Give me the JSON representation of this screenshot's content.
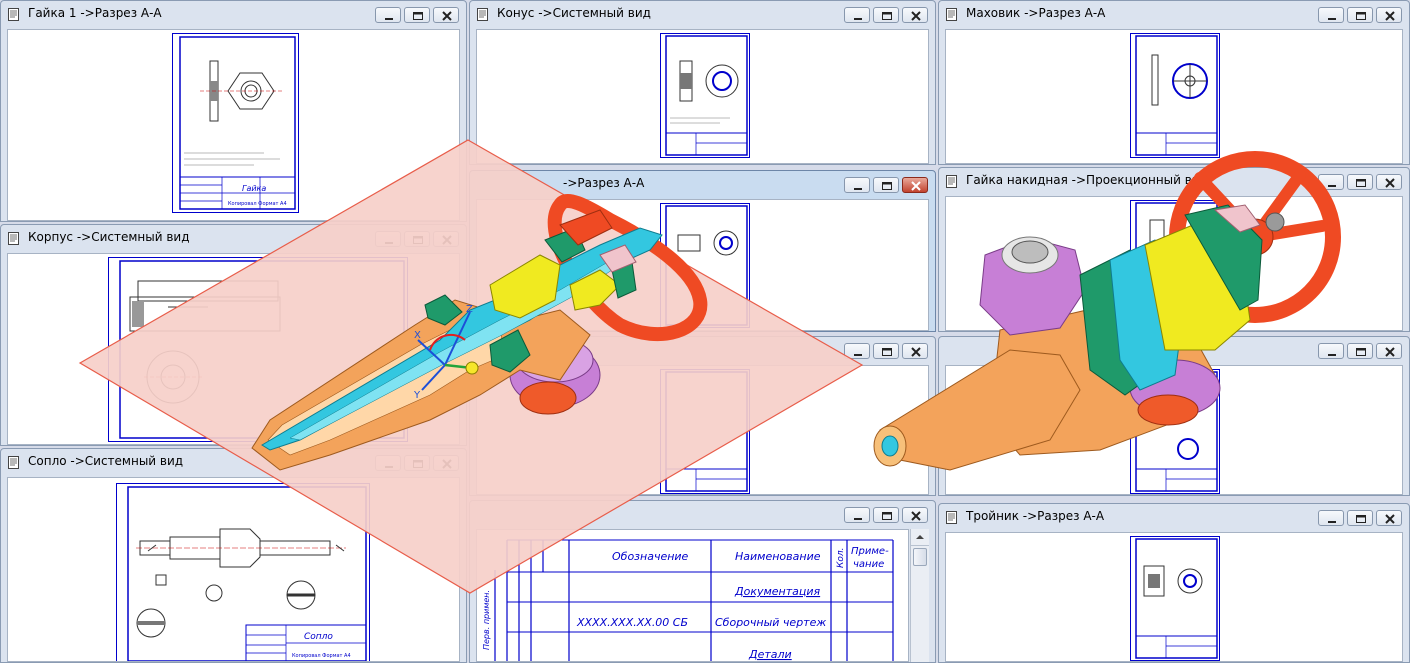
{
  "windows": [
    {
      "id": "gaika1",
      "title": "Гайка 1 ->Разрез А-А"
    },
    {
      "id": "konus",
      "title": "Конус ->Системный вид"
    },
    {
      "id": "mahovik",
      "title": "Маховик ->Разрез А-А"
    },
    {
      "id": "korpus",
      "title": "Корпус ->Системный вид"
    },
    {
      "id": "active",
      "title": "->Разрез А-А"
    },
    {
      "id": "nakidnaya",
      "title": "Гайка накидная ->Проекционный вид"
    },
    {
      "id": "soplo",
      "title": "Сопло ->Системный вид"
    },
    {
      "id": "spec",
      "title": ""
    },
    {
      "id": "hidden1",
      "title": ""
    },
    {
      "id": "hidden2",
      "title": ""
    },
    {
      "id": "troinik",
      "title": "Тройник ->Разрез А-А"
    }
  ],
  "spec_table": {
    "col_oboznachenie": "Обозначение",
    "col_naimenovanie": "Наименование",
    "col_kol": "Кол.",
    "col_prim1": "Приме-",
    "col_prim2": "чание",
    "section_doc": "Документация",
    "row1_code": "XXXX.XXX.XX.00 СБ",
    "row1_name": "Сборочный чертеж",
    "section_det": "Детали",
    "side_label": "Перв. примен."
  },
  "stamps": {
    "gaika": "Гайка",
    "soplo": "Сопло",
    "stamp_generic": "Копировал Формат А4"
  },
  "colors": {
    "frame_blue": "#0000cc",
    "plane_fill": "#f6cfc9",
    "plane_edge": "#e85d4a",
    "body_orange": "#f3a35b",
    "spindle_cyan": "#33c7e0",
    "nut_purple": "#c77fd6",
    "handwheel_red": "#ef4a23",
    "sleeve_yellow": "#f0ea20",
    "ring_green": "#1f9a6a"
  }
}
